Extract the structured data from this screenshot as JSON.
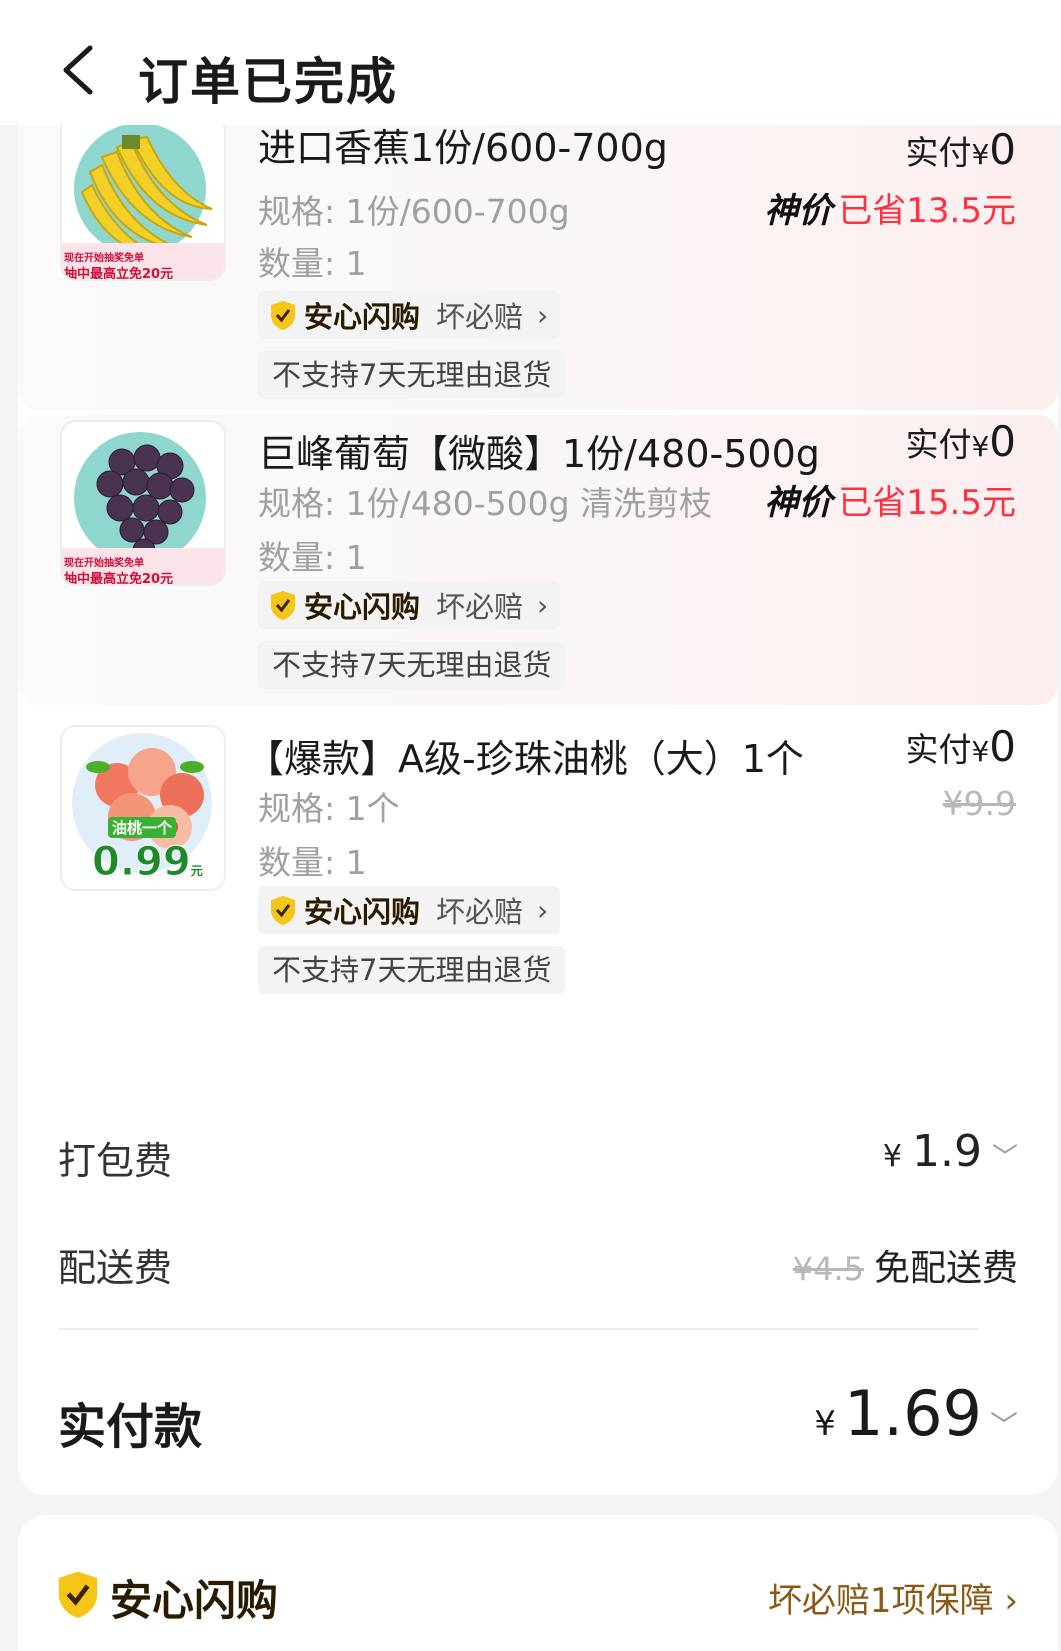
{
  "header": {
    "title": "订单已完成"
  },
  "items": [
    {
      "name": "进口香蕉1份/600-700g",
      "spec": "规格: 1份/600-700g",
      "qty": "数量: 1",
      "guard_name": "安心闪购",
      "guard_text": "坏必赔",
      "no_return": "不支持7天无理由退货",
      "paid_label": "实付",
      "paid_currency": "¥",
      "paid_value": "0",
      "promo_tag": "神价",
      "promo_saved": "已省13.5元",
      "image_banner": "抽中最高立免20元",
      "image_banner_small": "现在开始抽奖免单"
    },
    {
      "name": "巨峰葡萄【微酸】1份/480-500g",
      "spec": "规格: 1份/480-500g 清洗剪枝",
      "qty": "数量: 1",
      "guard_name": "安心闪购",
      "guard_text": "坏必赔",
      "no_return": "不支持7天无理由退货",
      "paid_label": "实付",
      "paid_currency": "¥",
      "paid_value": "0",
      "promo_tag": "神价",
      "promo_saved": "已省15.5元",
      "image_banner": "抽中最高立免20元",
      "image_banner_small": "现在开始抽奖免单"
    },
    {
      "name": "【爆款】A级-珍珠油桃（大）1个",
      "spec": "规格: 1个",
      "qty": "数量: 1",
      "guard_name": "安心闪购",
      "guard_text": "坏必赔",
      "no_return": "不支持7天无理由退货",
      "paid_label": "实付",
      "paid_currency": "¥",
      "paid_value": "0",
      "original_price": "¥9.9",
      "image_label": "油桃一个",
      "image_price": "0.99",
      "image_unit": "元"
    }
  ],
  "fees": {
    "packing_label": "打包费",
    "packing_currency": "¥",
    "packing_value": "1.9",
    "delivery_label": "配送费",
    "delivery_original": "¥4.5",
    "delivery_free": "免配送费"
  },
  "total": {
    "label": "实付款",
    "currency": "¥",
    "value": "1.69"
  },
  "guarantee": {
    "name": "安心闪购",
    "summary": "坏必赔1项保障"
  },
  "colors": {
    "accent_red": "#ff3040",
    "guard_brown": "#8a5a14",
    "shield_yellow": "#f5c518"
  },
  "icons": {
    "back": "chevron-left-icon",
    "shield": "shield-check-icon",
    "chevron": "chevron-down-icon"
  }
}
